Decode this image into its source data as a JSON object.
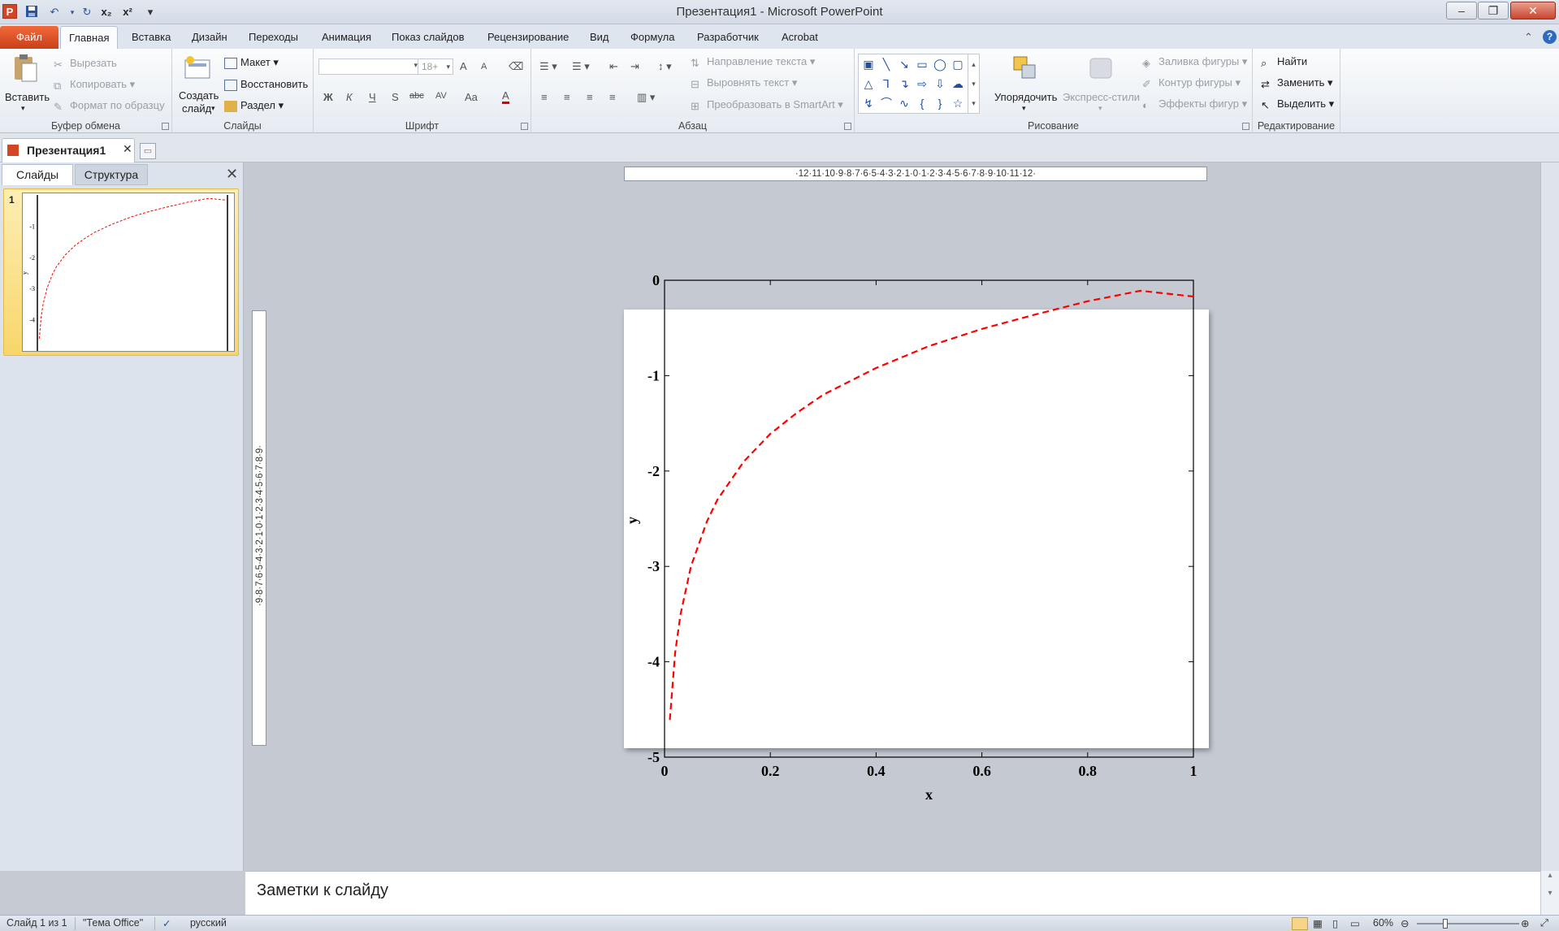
{
  "window": {
    "title": "Презентация1 - Microsoft PowerPoint",
    "app_icon": "P",
    "minimize": "–",
    "restore": "❐",
    "close": "✕"
  },
  "quick_access": {
    "save_icon": "save-icon",
    "undo_icon": "undo-icon",
    "redo_icon": "redo-icon",
    "subscript": "x₂",
    "superscript": "x²",
    "customize": "▾"
  },
  "ribbon_tabs": {
    "file": "Файл",
    "items": [
      "Главная",
      "Вставка",
      "Дизайн",
      "Переходы",
      "Анимация",
      "Показ слайдов",
      "Рецензирование",
      "Вид",
      "Формула",
      "Разработчик",
      "Acrobat"
    ],
    "active": "Главная"
  },
  "ribbon": {
    "clipboard": {
      "label": "Буфер обмена",
      "paste": "Вставить",
      "cut": "Вырезать",
      "copy": "Копировать",
      "format_painter": "Формат по образцу"
    },
    "slides": {
      "label": "Слайды",
      "new_slide_line1": "Создать",
      "new_slide_line2": "слайд",
      "layout": "Макет",
      "reset": "Восстановить",
      "section": "Раздел"
    },
    "font": {
      "label": "Шрифт",
      "font_name": "",
      "font_size": "18+",
      "grow": "A",
      "shrink": "A",
      "bold": "Ж",
      "italic": "К",
      "underline": "Ч",
      "strike": "S",
      "abc": "abc",
      "spacing": "AV",
      "case": "Aa",
      "color": "A"
    },
    "paragraph": {
      "label": "Абзац",
      "text_direction": "Направление текста",
      "align_text": "Выровнять текст",
      "smartart": "Преобразовать в SmartArt"
    },
    "drawing": {
      "label": "Рисование",
      "arrange": "Упорядочить",
      "quick_styles": "Экспресс-стили",
      "shape_fill": "Заливка фигуры",
      "shape_outline": "Контур фигуры",
      "shape_effects": "Эффекты фигур"
    },
    "editing": {
      "label": "Редактирование",
      "find": "Найти",
      "replace": "Заменить",
      "select": "Выделить"
    }
  },
  "document_tab": {
    "title": "Презентация1",
    "close": "✕"
  },
  "left_panel": {
    "tab_slides": "Слайды",
    "tab_outline": "Структура",
    "close": "✕",
    "slide_number": "1"
  },
  "rulers": {
    "horizontal": "·12·11·10·9·8·7·6·5·4·3·2·1·0·1·2·3·4·5·6·7·8·9·10·11·12·",
    "vertical": "·9·8·7·6·5·4·3·2·1·0·1·2·3·4·5·6·7·8·9·"
  },
  "chart_data": {
    "type": "line",
    "xlabel": "x",
    "ylabel": "y",
    "xlim": [
      0,
      1
    ],
    "ylim": [
      -5,
      0
    ],
    "x_ticks": [
      "0",
      "0.2",
      "0.4",
      "0.6",
      "0.8",
      "1"
    ],
    "y_ticks": [
      "0",
      "-1",
      "-2",
      "-3",
      "-4",
      "-5"
    ],
    "series": [
      {
        "color": "#ff0000",
        "style": "dashed",
        "x": [
          0.01,
          0.02,
          0.03,
          0.05,
          0.08,
          0.1,
          0.15,
          0.2,
          0.25,
          0.3,
          0.4,
          0.5,
          0.6,
          0.7,
          0.8,
          0.9,
          1.0
        ],
        "y": [
          -4.61,
          -3.91,
          -3.51,
          -3.0,
          -2.53,
          -2.3,
          -1.9,
          -1.61,
          -1.39,
          -1.2,
          -0.92,
          -0.69,
          -0.51,
          -0.36,
          -0.22,
          -0.11,
          -0.0
        ],
        "y_shown_at_right_edge": -0.17
      }
    ]
  },
  "notes": {
    "placeholder": "Заметки к слайду"
  },
  "status_bar": {
    "slide_info": "Слайд 1 из 1",
    "theme": "\"Тема Office\"",
    "language": "русский",
    "zoom": "60%"
  }
}
